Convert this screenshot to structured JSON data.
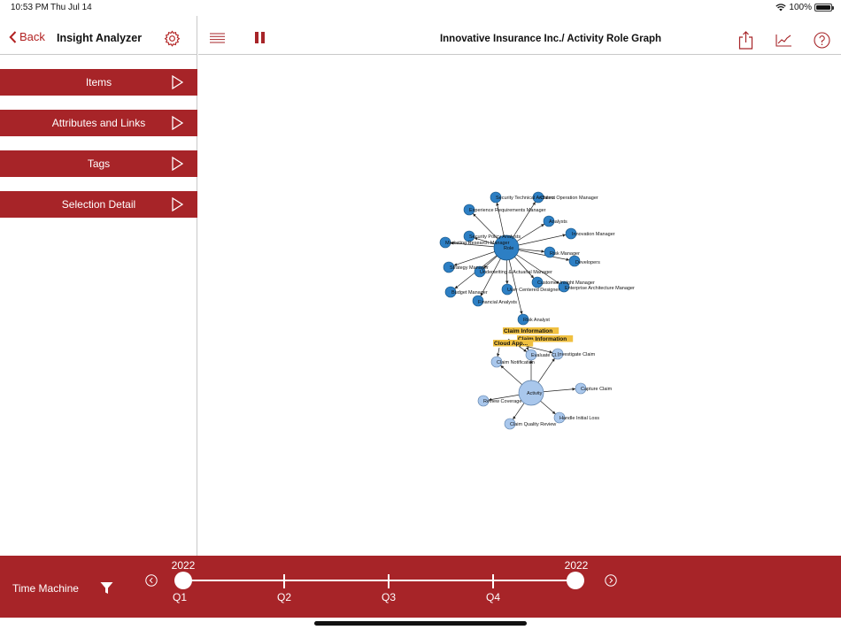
{
  "status_bar": {
    "time": "10:53 PM",
    "date": "Thu Jul 14",
    "battery": "100%"
  },
  "sidebar": {
    "back_label": "Back",
    "title": "Insight Analyzer",
    "items": [
      {
        "label": "Items"
      },
      {
        "label": "Attributes and Links"
      },
      {
        "label": "Tags"
      },
      {
        "label": "Selection Detail"
      }
    ]
  },
  "header": {
    "title": "Innovative Insurance Inc./ Activity Role Graph"
  },
  "graph": {
    "colors": {
      "role": "#2d7fc4",
      "activity": "#a9c7ec",
      "highlight": "#f0c040",
      "edge": "#222222"
    },
    "hub_labels": {
      "role": "Role",
      "analyst": "Risk Analyst",
      "activity": "Activity"
    },
    "role_nodes": [
      "Security Technical Architect",
      "Claims Operation Manager",
      "Experience Requirements Manager",
      "Analysts",
      "Innovation Manager",
      "Security Policy Analysts",
      "Marketing Research Manager",
      "Risk Manager",
      "Developers",
      "Strategy Manager",
      "Underwriting & Actuarial Manager",
      "Customer Insight Manager",
      "Enterprise Architecture Manager",
      "User Centered Designer",
      "Budget Manager",
      "Financial Analysts"
    ],
    "highlight_labels": [
      "Claim Information",
      "Claim Information",
      "Cloud App..."
    ],
    "activity_nodes": [
      "Claim Notification",
      "Evaluate Cl...",
      "Investigate Claim",
      "Capture Claim",
      "Handle Initial Loss",
      "Claim Quality Review",
      "Review Coverage"
    ]
  },
  "time_machine": {
    "title": "Time Machine",
    "start_year": "2022",
    "end_year": "2022",
    "quarters": [
      "Q1",
      "Q2",
      "Q3",
      "Q4"
    ]
  }
}
